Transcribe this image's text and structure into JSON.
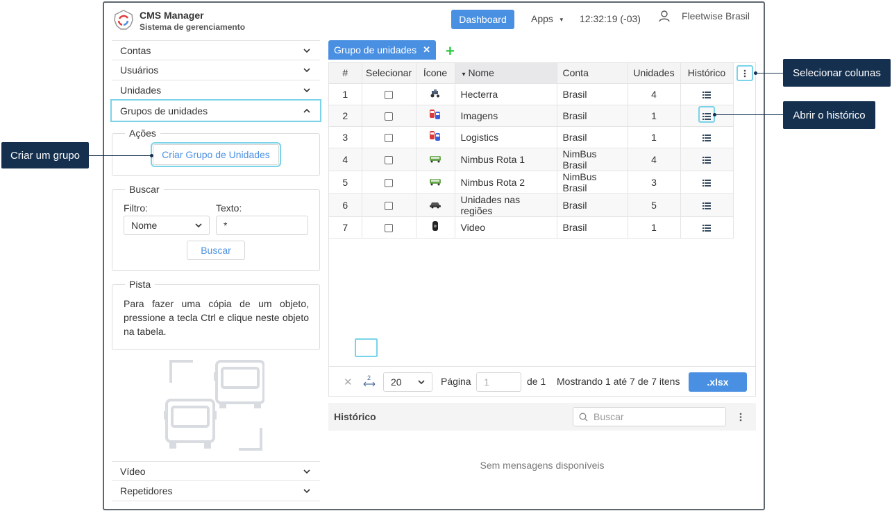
{
  "header": {
    "app_title": "CMS Manager",
    "app_subtitle": "Sistema de gerenciamento",
    "dashboard_label": "Dashboard",
    "apps_label": "Apps",
    "clock": "12:32:19 (-03)",
    "user_name": "Fleetwise Brasil"
  },
  "sidebar": {
    "items": [
      {
        "label": "Contas"
      },
      {
        "label": "Usuários"
      },
      {
        "label": "Unidades"
      },
      {
        "label": "Grupos de unidades"
      }
    ],
    "bottom_items": [
      {
        "label": "Vídeo"
      },
      {
        "label": "Repetidores"
      }
    ],
    "acoes": {
      "legend": "Ações",
      "create_button": "Criar Grupo de Unidades"
    },
    "buscar": {
      "legend": "Buscar",
      "filter_label": "Filtro:",
      "filter_value": "Nome",
      "text_label": "Texto:",
      "text_value": "*",
      "search_button": "Buscar"
    },
    "pista": {
      "legend": "Pista",
      "text": "Para fazer uma cópia de um objeto, pressione a tecla Ctrl e clique neste objeto na tabela."
    }
  },
  "tab": {
    "label": "Grupo de unidades",
    "close": "✕",
    "add": "+"
  },
  "table": {
    "columns": [
      "#",
      "Selecionar",
      "Ícone",
      "Nome",
      "Conta",
      "Unidades",
      "Histórico"
    ],
    "sort_indicator": "▾",
    "rows": [
      {
        "n": "1",
        "name": "Hecterra",
        "account": "Brasil",
        "units": "4",
        "icon": "tractor-icon"
      },
      {
        "n": "2",
        "name": "Imagens",
        "account": "Brasil",
        "units": "1",
        "icon": "cars-icon"
      },
      {
        "n": "3",
        "name": "Logistics",
        "account": "Brasil",
        "units": "1",
        "icon": "cars-icon"
      },
      {
        "n": "4",
        "name": "Nimbus Rota 1",
        "account": "NimBus Brasil",
        "units": "4",
        "icon": "bus-icon"
      },
      {
        "n": "5",
        "name": "Nimbus Rota 2",
        "account": "NimBus Brasil",
        "units": "3",
        "icon": "bus-icon"
      },
      {
        "n": "6",
        "name": "Unidades nas regiões",
        "account": "Brasil",
        "units": "5",
        "icon": "car-icon"
      },
      {
        "n": "7",
        "name": "Video",
        "account": "Brasil",
        "units": "1",
        "icon": "camera-icon"
      }
    ]
  },
  "pager": {
    "page_size": "20",
    "page_label": "Página",
    "page_value": "1",
    "of_label": "de 1",
    "showing": "Mostrando 1 até 7 de 7 itens",
    "export_label": ".xlsx",
    "sort_number": "2"
  },
  "history": {
    "title": "Histórico",
    "search_placeholder": "Buscar",
    "empty_message": "Sem mensagens disponíveis"
  },
  "callouts": {
    "select_columns": "Selecionar colunas",
    "open_history": "Abrir o histórico",
    "create_group": "Criar um grupo"
  },
  "colors": {
    "accent": "#4a90e2",
    "highlight": "#7ad3e8",
    "callout_bg": "#15304f",
    "add_green": "#2ecc40"
  }
}
